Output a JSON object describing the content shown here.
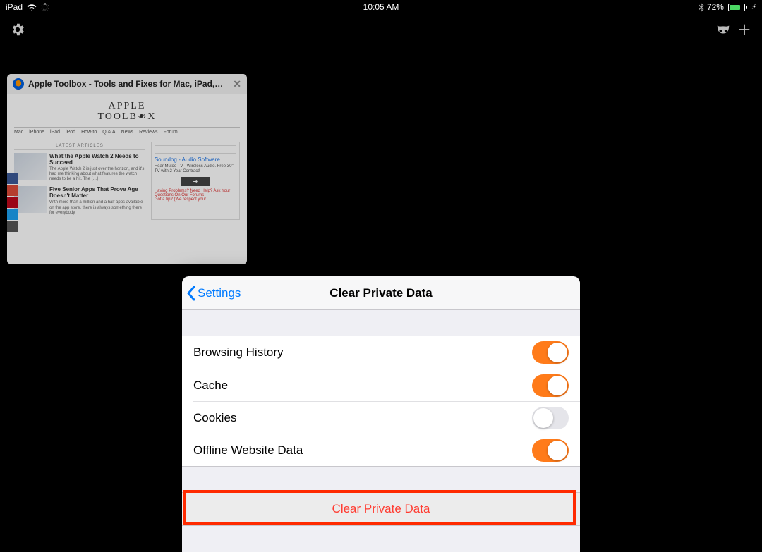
{
  "status": {
    "device": "iPad",
    "time": "10:05 AM",
    "battery_pct": "72%"
  },
  "tab": {
    "title": "Apple Toolbox - Tools and Fixes for Mac, iPad,…",
    "logo_line1": "APPLE",
    "logo_line2": "TOOLB☙X",
    "nav": [
      "Mac",
      "iPhone",
      "iPad",
      "iPod",
      "How-to",
      "Q & A",
      "News",
      "Reviews",
      "Forum"
    ],
    "latest_label": "LATEST ARTICLES",
    "articles": [
      {
        "title": "What the Apple Watch 2 Needs to Succeed",
        "blurb": "The Apple Watch 2 is just over the horizon, and it's had me thinking about what features the watch needs to be a hit. The […]"
      },
      {
        "title": "Five Senior Apps That Prove Age Doesn't Matter",
        "blurb": "With more than a million and a half apps available on the app store, there is always something there for everybody."
      }
    ],
    "sidebar": {
      "ad_title": "Soundog - Audio Software",
      "ad_text": "Hear Mutoo TV - Wireless Audio. Free 30\" TV with 2 Year Contract!",
      "arrow": "➔",
      "foot1": "Having Problems? Need Help? Ask Your Questions On Our Forums",
      "foot2": "Got a tip? (We respect your…"
    }
  },
  "modal": {
    "back_label": "Settings",
    "title": "Clear Private Data",
    "rows": [
      {
        "label": "Browsing History",
        "on": true
      },
      {
        "label": "Cache",
        "on": true
      },
      {
        "label": "Cookies",
        "on": false
      },
      {
        "label": "Offline Website Data",
        "on": true
      }
    ],
    "action": "Clear Private Data"
  }
}
